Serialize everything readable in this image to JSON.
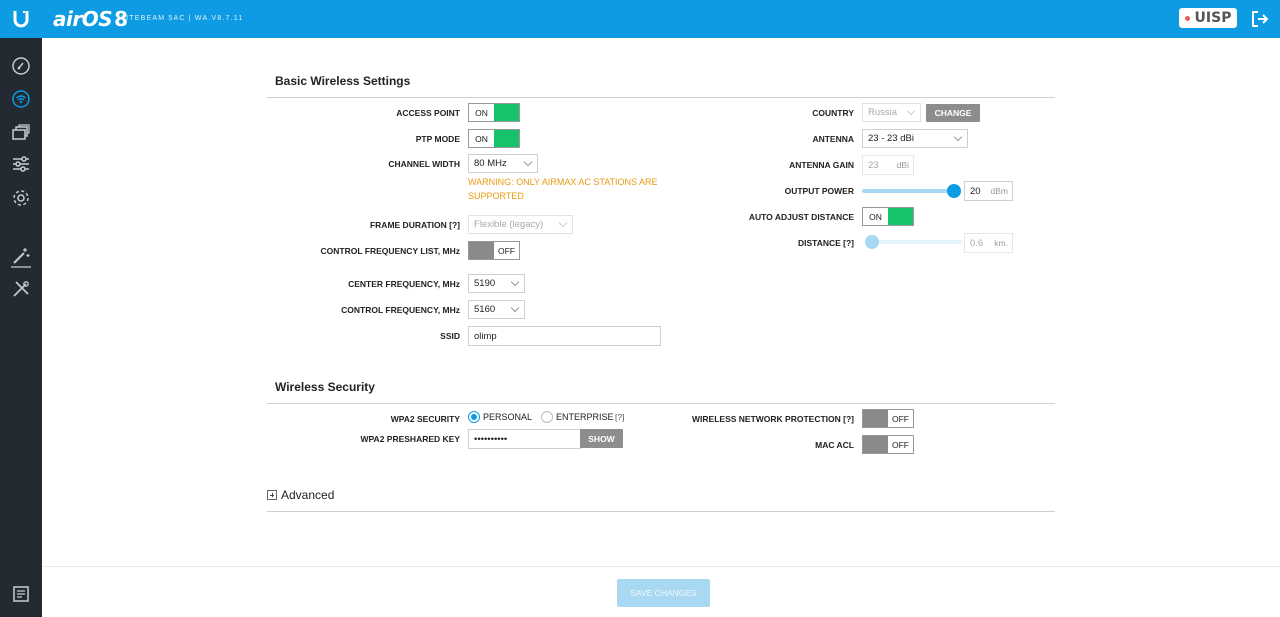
{
  "header": {
    "brand": "airOS",
    "version_mark": "8",
    "device": "LITEBEAM 5AC | WA.V8.7.11",
    "uisp_label": "UISP"
  },
  "sidebar": {
    "items": [
      {
        "icon": "dashboard-icon"
      },
      {
        "icon": "wireless-icon"
      },
      {
        "icon": "network-icon"
      },
      {
        "icon": "services-icon"
      },
      {
        "icon": "settings-gear-icon"
      },
      {
        "icon": "wizard-wand-icon"
      },
      {
        "icon": "tools-icon"
      },
      {
        "icon": "log-icon"
      }
    ]
  },
  "basic": {
    "title": "Basic Wireless Settings",
    "access_point_label": "ACCESS POINT",
    "access_point_value": "ON",
    "ptp_mode_label": "PTP MODE",
    "ptp_mode_value": "ON",
    "channel_width_label": "CHANNEL WIDTH",
    "channel_width_value": "80 MHz",
    "warning": "WARNING: ONLY AIRMAX AC STATIONS ARE SUPPORTED",
    "frame_duration_label": "FRAME DURATION [?]",
    "frame_duration_value": "Flexible (legacy)",
    "control_freq_list_label": "CONTROL FREQUENCY LIST, MHz",
    "control_freq_list_value": "OFF",
    "center_freq_label": "CENTER FREQUENCY, MHz",
    "center_freq_value": "5190",
    "control_freq_label": "CONTROL FREQUENCY, MHz",
    "control_freq_value": "5160",
    "ssid_label": "SSID",
    "ssid_value": "olimp",
    "country_label": "COUNTRY",
    "country_value": "Russia",
    "change_label": "CHANGE",
    "antenna_label": "ANTENNA",
    "antenna_value": "23 - 23 dBi",
    "antenna_gain_label": "ANTENNA GAIN",
    "antenna_gain_value": "23",
    "antenna_gain_unit": "dBi",
    "output_power_label": "OUTPUT POWER",
    "output_power_value": "20",
    "output_power_unit": "dBm",
    "output_power_level": 1.0,
    "auto_adjust_label": "AUTO ADJUST DISTANCE",
    "auto_adjust_value": "ON",
    "distance_label": "DISTANCE [?]",
    "distance_value": "0.6",
    "distance_unit": "km.",
    "distance_level": 0.0
  },
  "security": {
    "title": "Wireless Security",
    "wpa2_label": "WPA2 SECURITY",
    "personal_label": "PERSONAL",
    "enterprise_label": "ENTERPRISE",
    "enterprise_help": "[?]",
    "selected": "PERSONAL",
    "psk_label": "WPA2 PRESHARED KEY",
    "psk_value": "••••••••••",
    "show_label": "SHOW",
    "wnp_label": "WIRELESS NETWORK PROTECTION [?]",
    "wnp_value": "OFF",
    "mac_acl_label": "MAC ACL",
    "mac_acl_value": "OFF"
  },
  "advanced_label": "Advanced",
  "save_label": "SAVE CHANGES",
  "colors": {
    "header": "#0d9be3",
    "sidebar": "#232a31",
    "toggle_on": "#17c36a",
    "toggle_off": "#8a8a8a",
    "warning": "#e89a10"
  }
}
